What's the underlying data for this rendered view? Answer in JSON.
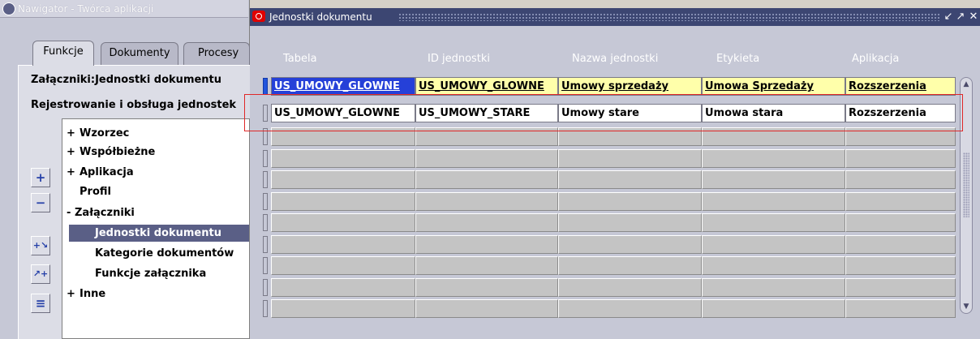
{
  "navigator": {
    "title": "Nawigator - Twórca aplikacji",
    "tabs": [
      "Funkcje",
      "Dokumenty",
      "Procesy"
    ],
    "heading1": "Załączniki:Jednostki dokumentu",
    "heading2": "Rejestrowanie i obsługa jednostek",
    "tree": [
      {
        "prefix": "+",
        "label": "Wzorzec"
      },
      {
        "prefix": "+",
        "label": "Współbieżne"
      },
      {
        "prefix": "+",
        "label": "Aplikacja"
      },
      {
        "prefix": "",
        "label": "Profil"
      },
      {
        "prefix": "-",
        "label": "Załączniki"
      },
      {
        "prefix": "",
        "label": "Jednostki dokumentu"
      },
      {
        "prefix": "",
        "label": "Kategorie dokumentów"
      },
      {
        "prefix": "",
        "label": "Funkcje załącznika"
      },
      {
        "prefix": "+",
        "label": "Inne"
      }
    ],
    "selected_item": "Jednostki dokumentu",
    "side_buttons": [
      "expand-icon",
      "collapse-icon",
      "expand-branch-icon",
      "expand-all-icon",
      "collapse-all-icon"
    ]
  },
  "window": {
    "title": "Jednostki dokumentu",
    "controls": [
      "minimize-icon",
      "maximize-icon",
      "close-icon"
    ],
    "columns": [
      "Tabela",
      "ID jednostki",
      "Nazwa jednostki",
      "Etykieta",
      "Aplikacja"
    ],
    "rows": [
      [
        "US_UMOWY_GLOWNE",
        "US_UMOWY_GLOWNE",
        "Umowy sprzedaży",
        "Umowa Sprzedaży",
        "Rozszerzenia"
      ],
      [
        "US_UMOWY_GLOWNE",
        "US_UMOWY_STARE",
        "Umowy stare",
        "Umowa stara",
        "Rozszerzenia"
      ]
    ],
    "empty_row_count": 9
  },
  "colors": {
    "title_bar": "#3c4672",
    "selected_row": "#ffffaa",
    "highlight_cell": "#2540d8",
    "annotation_box": "#e02828"
  }
}
